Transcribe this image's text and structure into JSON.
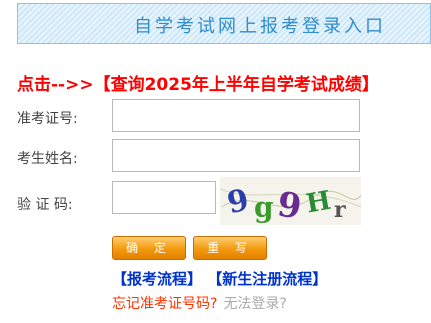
{
  "header": {
    "title": "自学考试网上报考登录入口"
  },
  "notice": {
    "text": "点击-->>【查询2025年上半年自学考试成绩】"
  },
  "form": {
    "id_label": "准考证号:",
    "id_value": "",
    "name_label": "考生姓名:",
    "name_value": "",
    "captcha_label": "验 证 码:",
    "captcha_value": "",
    "captcha_image_text": "9g9Hr"
  },
  "buttons": {
    "confirm": "确 定",
    "rewrite": "重 写"
  },
  "links": {
    "process": "【报考流程】",
    "register": "【新生注册流程】"
  },
  "help": {
    "forgot_id": "忘记准考证号码?",
    "cannot_login": "无法登录?"
  },
  "colors": {
    "notice": "#ff0000",
    "links": "#0033cc",
    "button": "#f39a0c"
  }
}
